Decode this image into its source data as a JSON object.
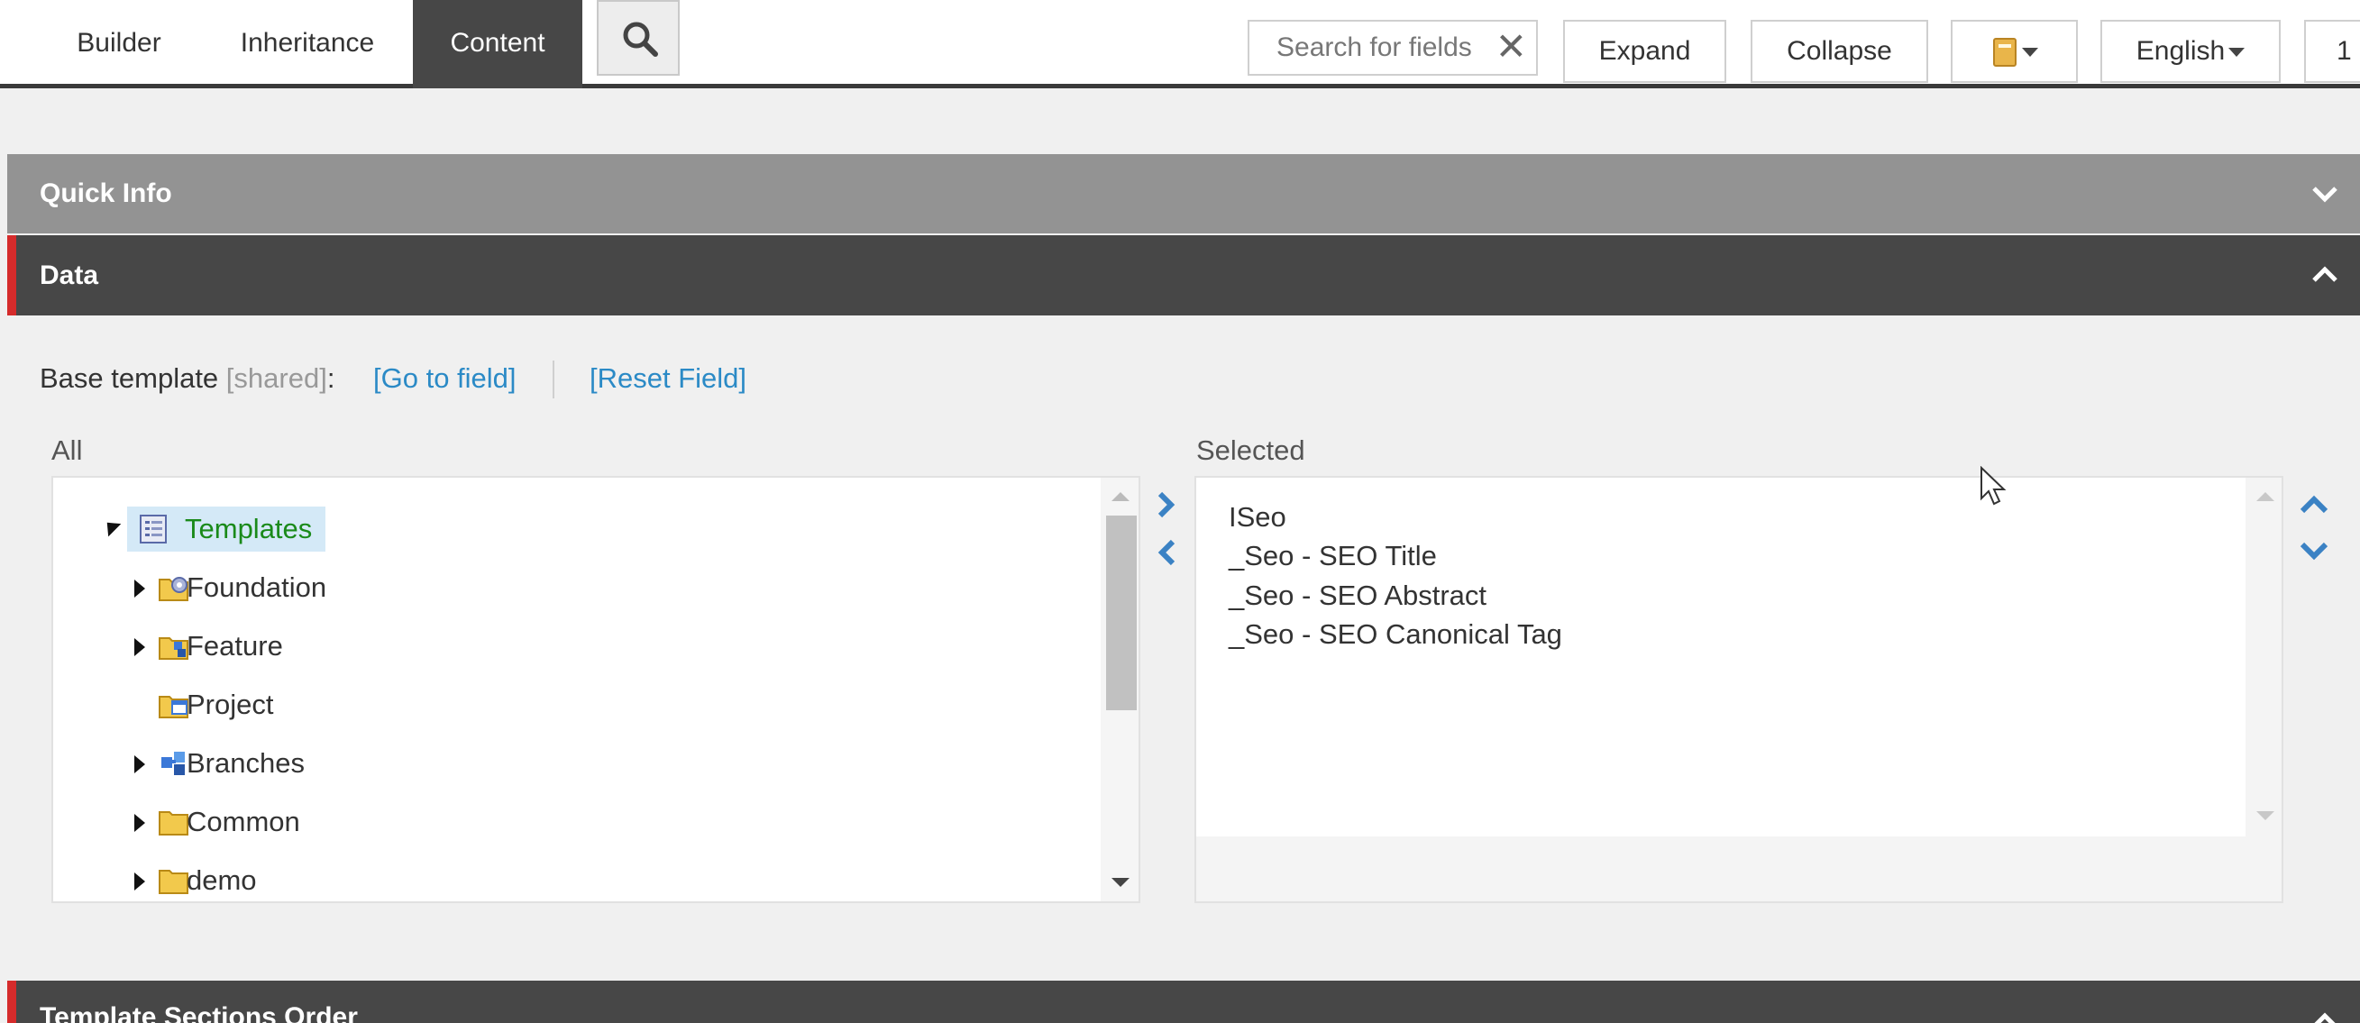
{
  "tabs": [
    {
      "label": "Builder"
    },
    {
      "label": "Inheritance"
    },
    {
      "label": "Content",
      "active": true
    }
  ],
  "toolbar": {
    "search_placeholder": "Search for fields",
    "expand_label": "Expand",
    "collapse_label": "Collapse",
    "language_label": "English",
    "version_partial": "1"
  },
  "sections": {
    "quick_info": "Quick Info",
    "data": "Data",
    "template_sections_order": "Template Sections Order"
  },
  "field": {
    "label": "Base template",
    "shared_tag": "[shared]",
    "colon": ":",
    "goto_link": "[Go to field]",
    "reset_link": "[Reset Field]"
  },
  "all_panel": {
    "title": "All",
    "root": "Templates",
    "items": [
      {
        "label": "Foundation",
        "icon": "foundation-folder-icon",
        "expandable": true
      },
      {
        "label": "Feature",
        "icon": "feature-folder-icon",
        "expandable": true
      },
      {
        "label": "Project",
        "icon": "project-folder-icon",
        "expandable": false
      },
      {
        "label": "Branches",
        "icon": "branches-icon",
        "expandable": true
      },
      {
        "label": "Common",
        "icon": "folder-icon",
        "expandable": true
      },
      {
        "label": "demo",
        "icon": "folder-icon",
        "expandable": true
      }
    ]
  },
  "selected_panel": {
    "title": "Selected",
    "items": [
      "ISeo",
      "_Seo - SEO Title",
      "_Seo - SEO Abstract",
      "_Seo - SEO Canonical Tag"
    ]
  },
  "colors": {
    "active_tab": "#474747",
    "link": "#2b8ac6",
    "accent_red": "#d52b2b",
    "root_text": "#1a8a1a",
    "root_highlight": "#d4e9f7"
  }
}
